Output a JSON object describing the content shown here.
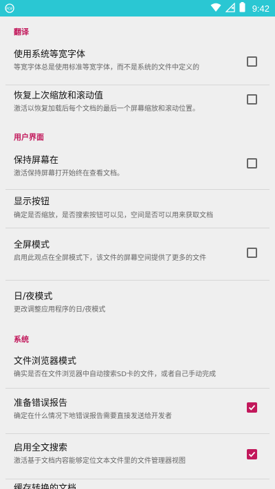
{
  "status_bar": {
    "time": "9:42"
  },
  "sections": {
    "translation": "翻译",
    "ui": "用户界面",
    "system": "系统"
  },
  "settings": {
    "monospace": {
      "title": "使用系统等宽字体",
      "summary": "等宽字体总是使用标准等宽字体，而不是系统的文件中定义的",
      "checked": false
    },
    "restore_zoom": {
      "title": "恢复上次缩放和滚动值",
      "summary": "激活以恢复加载后每个文档的最后一个屏幕缩放和滚动位置。",
      "checked": false
    },
    "keep_screen": {
      "title": "保持屏幕在",
      "summary": "激活保持屏幕打开始终在查看文档。",
      "checked": false
    },
    "show_buttons": {
      "title": "显示按钮",
      "summary": "确定是否缩放，是否搜索按钮可以见，空间是否可以用来获取文档"
    },
    "fullscreen": {
      "title": "全屏模式",
      "summary": "启用此观点在全屏模式下，该文件的屏幕空间提供了更多的文件",
      "checked": false
    },
    "day_night": {
      "title": "日/夜模式",
      "summary": "更改调整应用程序的日/夜模式"
    },
    "browser_mode": {
      "title": "文件浏览器模式",
      "summary": "确实是否在文件浏览器中自动搜索SD卡的文件，或者自己手动完成"
    },
    "error_report": {
      "title": "准备错误报告",
      "summary": "确定在什么情况下地错误报告需要直接发送给开发者",
      "checked": true
    },
    "fulltext_search": {
      "title": "启用全文搜索",
      "summary": "激活基于文档内容能够定位文本文件里的文件管理器视图",
      "checked": true
    },
    "cache_docs": {
      "title": "缓存转换的文档"
    }
  },
  "colors": {
    "status_bar": "#2ac7d3",
    "accent": "#c2185b",
    "background": "#efefef"
  }
}
